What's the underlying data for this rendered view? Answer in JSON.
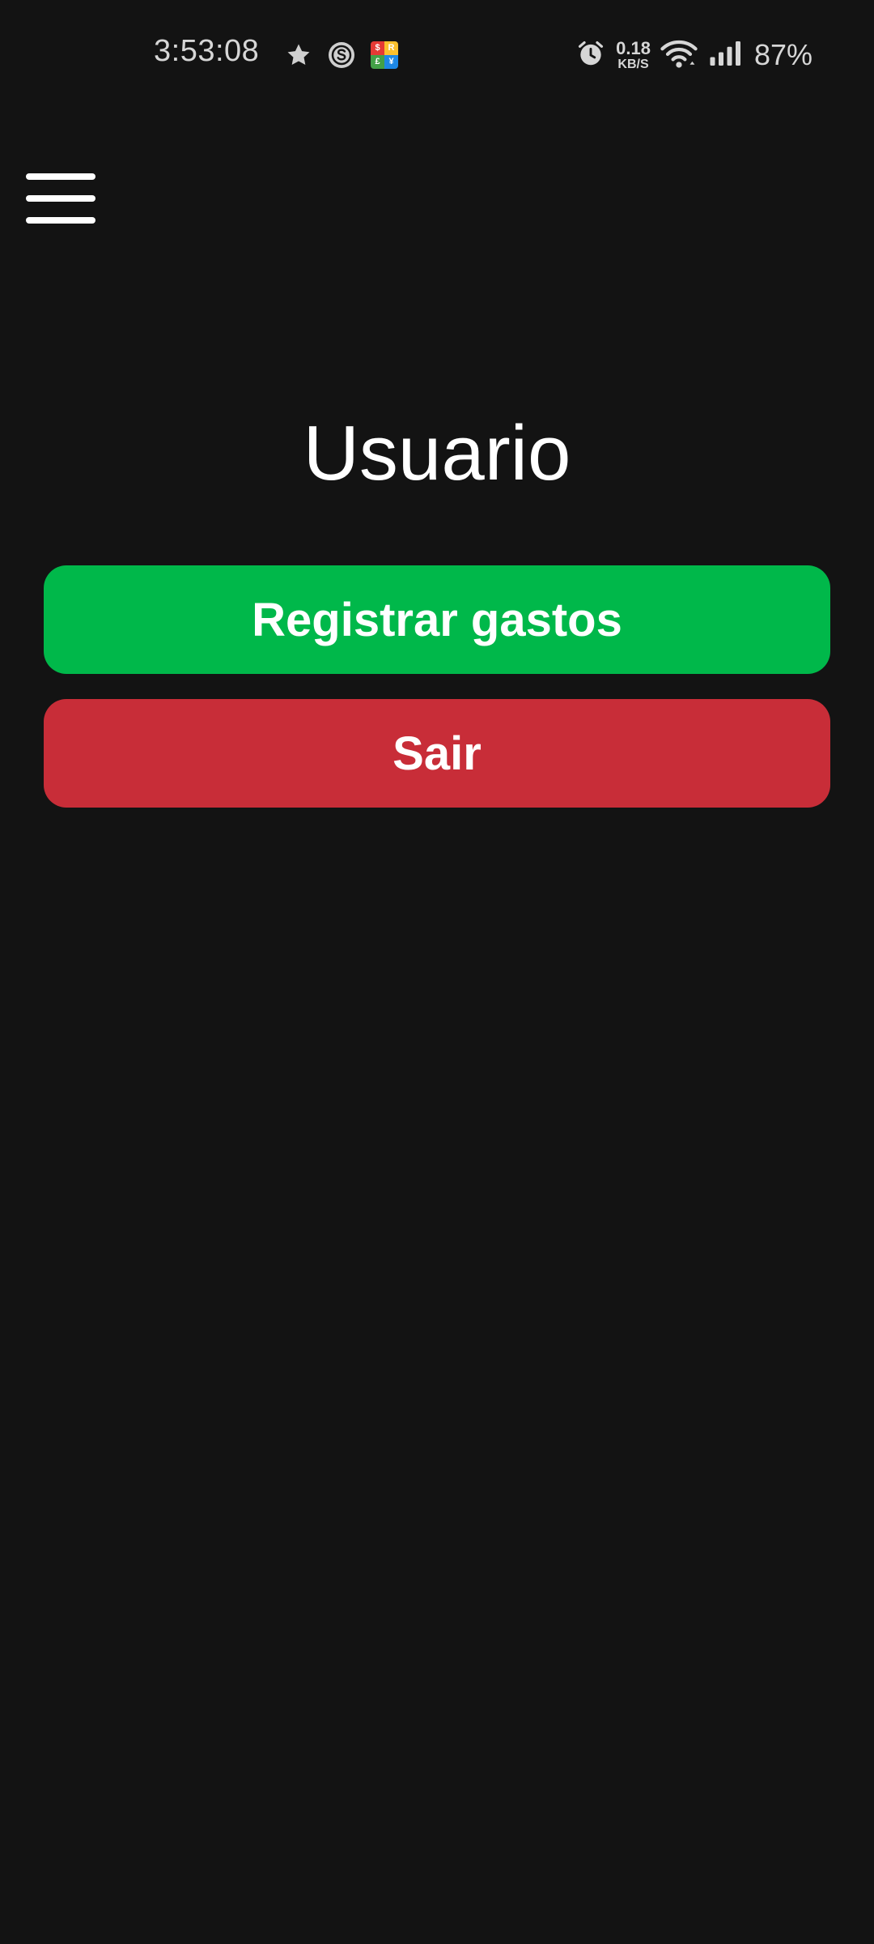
{
  "status_bar": {
    "time": "3:53:08",
    "notification_icons": [
      "star-icon",
      "s-circle-icon",
      "currency-grid-icon"
    ],
    "currency_grid_letters": [
      "$",
      "R",
      "£",
      "¥"
    ],
    "net_speed_value": "0.18",
    "net_speed_unit": "KB/S",
    "battery": "87%",
    "icons": [
      "alarm-icon",
      "wifi-icon",
      "signal-icon"
    ]
  },
  "header": {
    "menu_icon": "hamburger-menu-icon"
  },
  "main": {
    "title": "Usuario",
    "register_button_label": "Registrar gastos",
    "exit_button_label": "Sair"
  },
  "colors": {
    "background": "#131313",
    "register_button": "#00b84a",
    "exit_button": "#c82d38",
    "text": "#ffffff",
    "status_text": "#d6d6d6"
  }
}
